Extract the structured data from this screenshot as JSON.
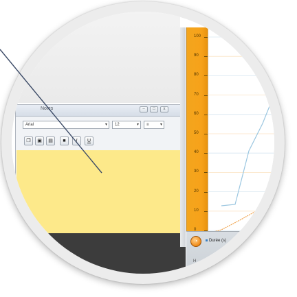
{
  "notes_window": {
    "title": "Notes",
    "font_family": "Arial",
    "font_size": "12",
    "title_buttons": [
      "–",
      "□",
      "x"
    ],
    "toolbar_icons": [
      "copy-icon",
      "paste-icon",
      "print-icon",
      "bold-icon",
      "italic-icon",
      "underline-icon"
    ],
    "italic_label": "I",
    "underline_label": "U",
    "bold_label": "■",
    "note_color": "#fde98a"
  },
  "chart": {
    "axis_color": "#f7a21a",
    "y_ticks": [
      "100",
      "90",
      "80",
      "70",
      "60",
      "50",
      "40",
      "30",
      "20",
      "10",
      "0"
    ]
  },
  "status_bar": {
    "legend_label": "Durée (s)",
    "row2_label": "H"
  }
}
